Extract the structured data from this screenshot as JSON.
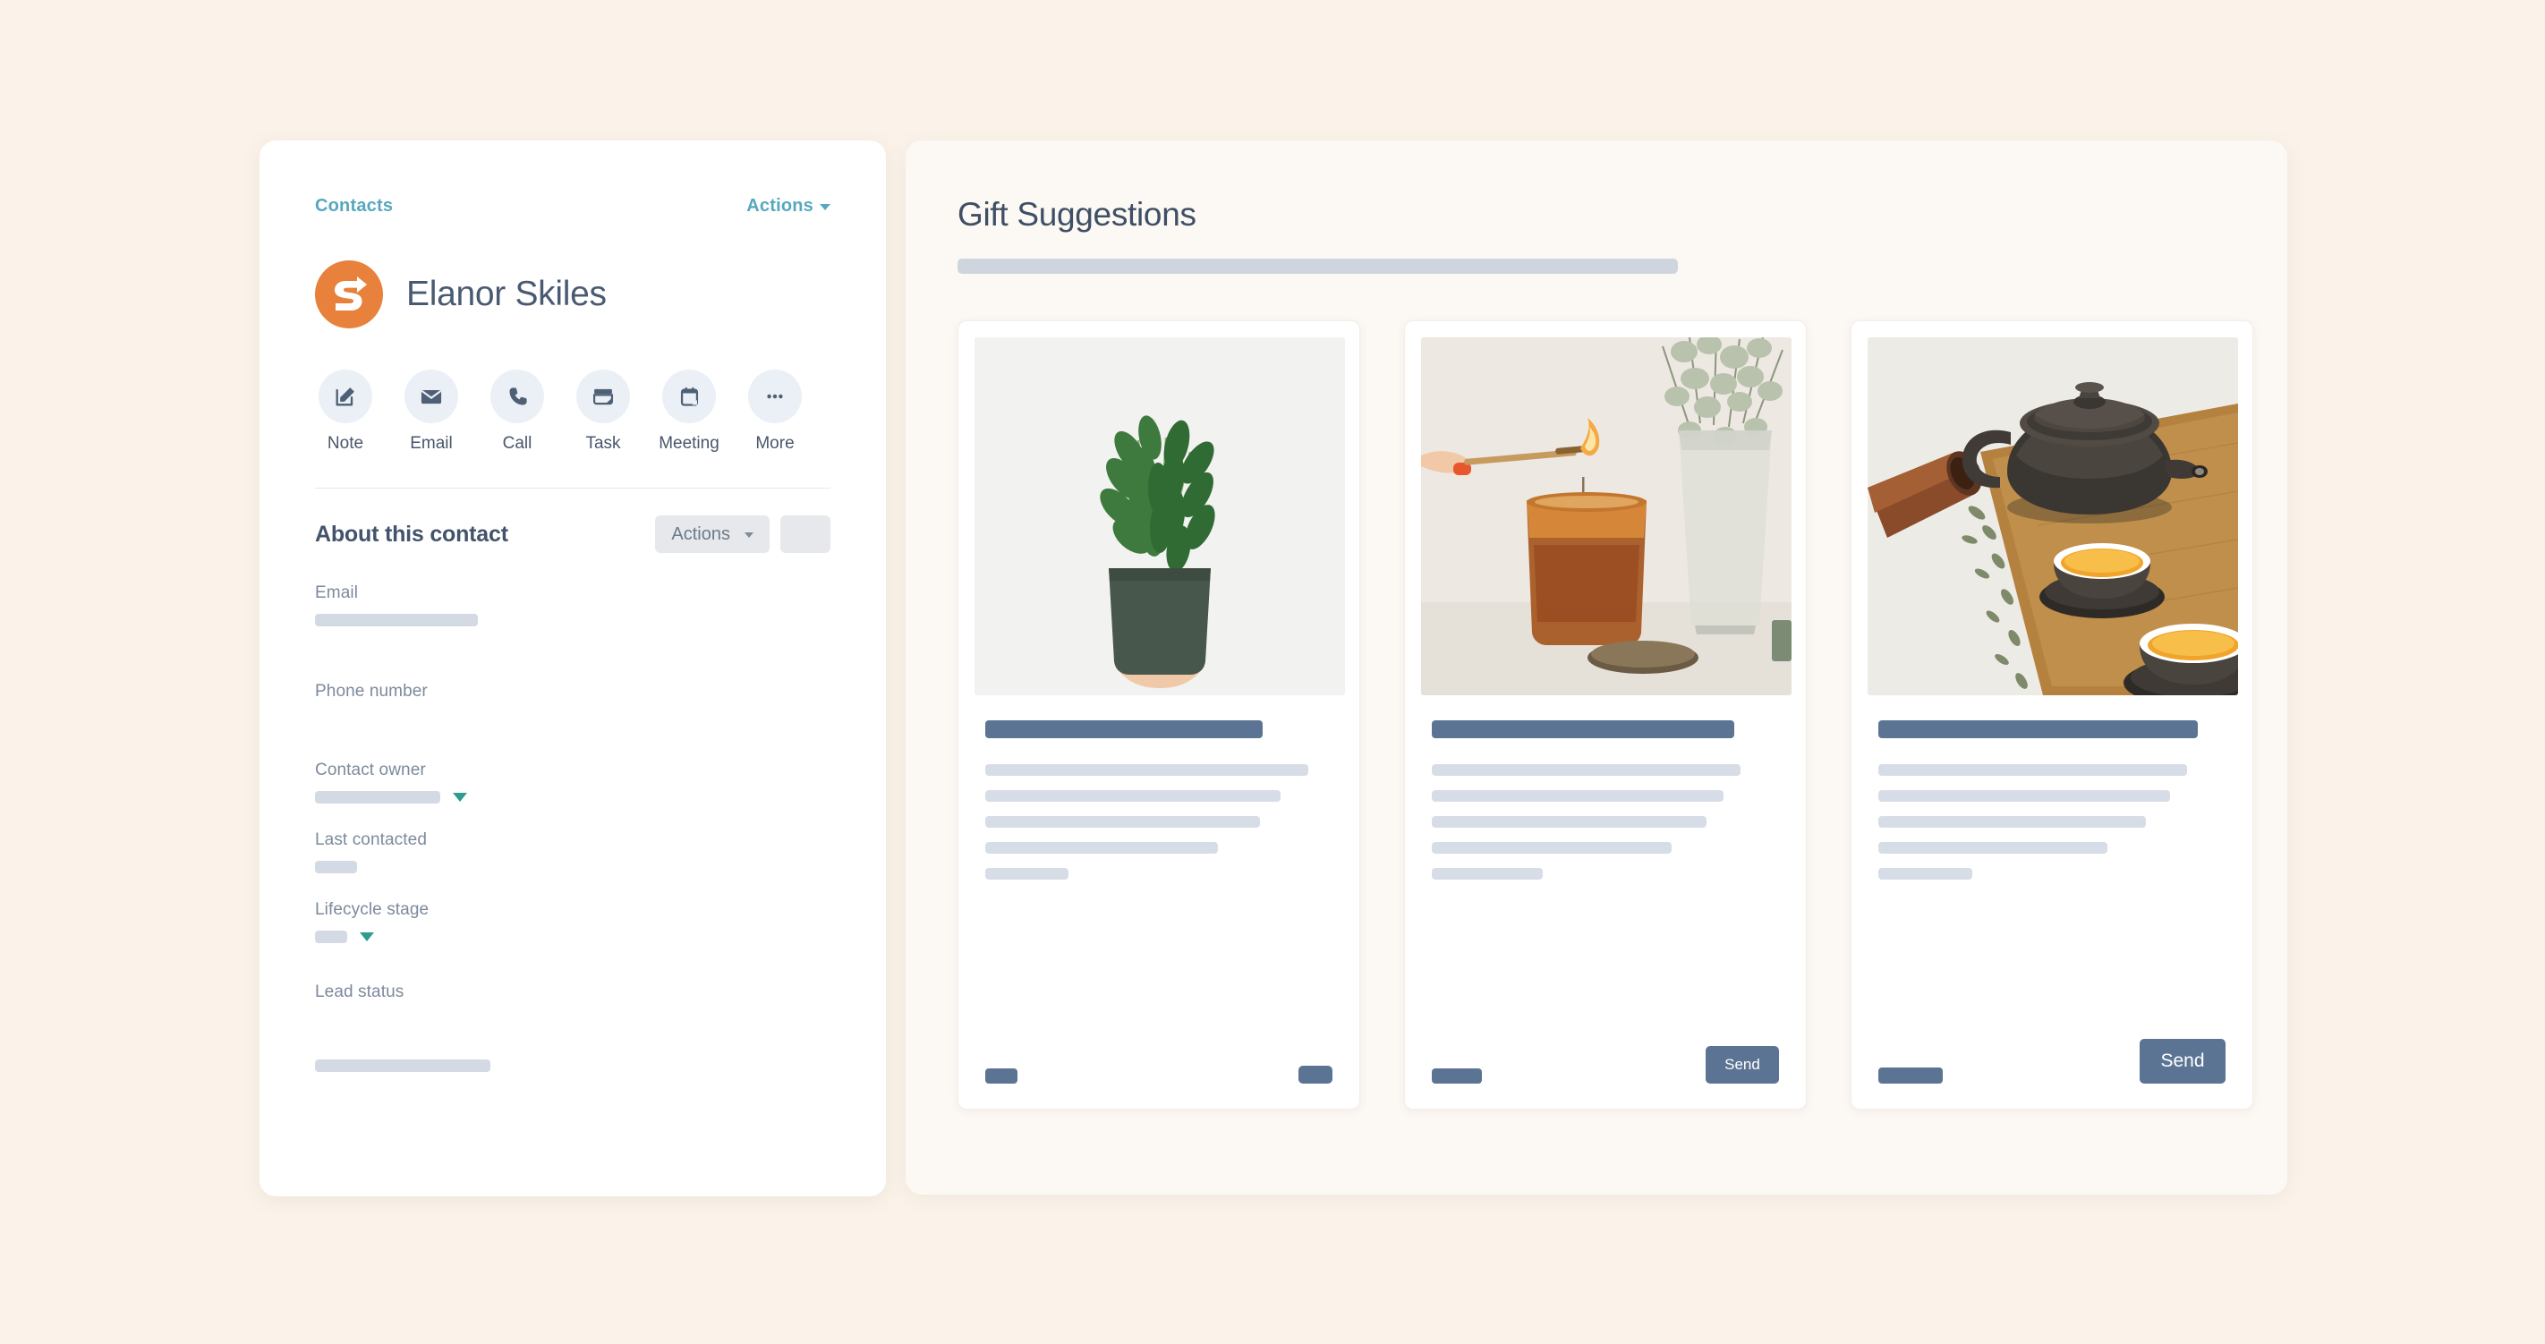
{
  "theme": {
    "page_bg": "#FBF3EA",
    "panel_bg": "#FFFFFF",
    "suggest_panel_bg": "#FCF8F3",
    "link_color": "#57A8BE",
    "avatar_color": "#E8813C",
    "accent_slate": "#5C7493",
    "skeleton_gray": "#D4DAE3",
    "teal_caret": "#2E9B8F",
    "text_dark": "#43536B",
    "label_gray": "#7C8A9B"
  },
  "contact_panel": {
    "breadcrumb_label": "Contacts",
    "top_actions_label": "Actions",
    "avatar_icon": "s-arrow-logo",
    "contact_name": "Elanor Skiles",
    "quick_actions": [
      {
        "label": "Note",
        "icon": "note-pencil-icon"
      },
      {
        "label": "Email",
        "icon": "envelope-icon"
      },
      {
        "label": "Call",
        "icon": "phone-icon"
      },
      {
        "label": "Task",
        "icon": "task-card-icon"
      },
      {
        "label": "Meeting",
        "icon": "calendar-icon"
      },
      {
        "label": "More",
        "icon": "ellipsis-icon"
      }
    ],
    "about": {
      "title": "About this contact",
      "actions_label": "Actions",
      "blank_button_label": ""
    },
    "fields": [
      {
        "label": "Email",
        "value_width": 182,
        "has_caret": false,
        "gap_after": 62
      },
      {
        "label": "Phone number",
        "value_width": 0,
        "has_caret": false,
        "gap_after": 66
      },
      {
        "label": "Contact owner",
        "value_width": 140,
        "has_caret": true,
        "gap_after": 30
      },
      {
        "label": "Last contacted",
        "value_width": 47,
        "has_caret": false,
        "gap_after": 30
      },
      {
        "label": "Lifecycle stage",
        "value_width": 36,
        "has_caret": true,
        "gap_after": 44
      },
      {
        "label": "Lead status",
        "value_width": 0,
        "has_caret": false,
        "gap_after": 62
      }
    ],
    "footer_skeleton_width": 196
  },
  "suggestions_panel": {
    "title": "Gift Suggestions",
    "subtitle_skeleton": true,
    "cards": [
      {
        "image_alt": "potted-zz-plant-held-in-hand",
        "title_bar_pct": 80,
        "text_line_pcts": [
          93,
          85,
          79,
          67,
          24
        ],
        "foot_pill_width": 36,
        "send_label": "",
        "send_width": 38,
        "send_height": 20
      },
      {
        "image_alt": "hand-lighting-amber-candle-with-eucalyptus",
        "title_bar_pct": 87,
        "text_line_pcts": [
          89,
          84,
          79,
          69,
          32
        ],
        "foot_pill_width": 56,
        "send_label": "Send",
        "send_width": 82,
        "send_height": 42
      },
      {
        "image_alt": "clay-teapot-and-cups-on-wooden-tray",
        "title_bar_pct": 92,
        "text_line_pcts": [
          89,
          84,
          77,
          66,
          27
        ],
        "foot_pill_width": 72,
        "send_label": "Send",
        "send_width": 96,
        "send_height": 50
      }
    ]
  }
}
